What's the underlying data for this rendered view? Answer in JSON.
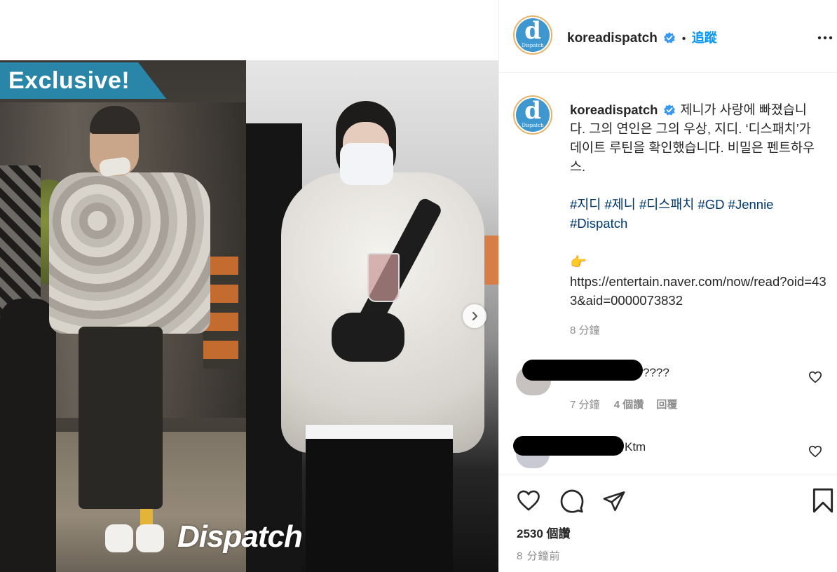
{
  "media": {
    "badge_text": "Exclusive!",
    "watermark_text": "Dispatch"
  },
  "post": {
    "username": "koreadispatch",
    "follow_label": "追蹤",
    "separator": "•",
    "caption_text": "제니가 사랑에 빠졌습니다. 그의 연인은 그의 우상, 지디. ‘디스패치’가 데이트 루틴을 확인했습니다. 비밀은 펜트하우스.",
    "hashtags": [
      "#지디",
      "#제니",
      "#디스패치",
      "#GD",
      "#Jennie",
      "#Dispatch"
    ],
    "pointing_emoji": "👉",
    "link_text": "https://entertain.naver.com/now/read?oid=433&aid=0000073832",
    "caption_time": "8 分鐘"
  },
  "comments": [
    {
      "text": "????",
      "time": "7 分鐘",
      "likes": "4 個讚",
      "reply_label": "回覆"
    },
    {
      "text": "Ktm"
    }
  ],
  "footer": {
    "likes_count": "2530 個讚",
    "post_time": "8 分鐘前"
  },
  "colors": {
    "accent_blue": "#0095f6",
    "hashtag_blue": "#00376b",
    "verified_blue": "#3897f0",
    "muted_gray": "#8e8e8e"
  },
  "icons": [
    "verified-badge-icon",
    "more-options-icon",
    "next-slide-icon",
    "heart-icon",
    "comment-icon",
    "share-icon",
    "bookmark-icon"
  ]
}
